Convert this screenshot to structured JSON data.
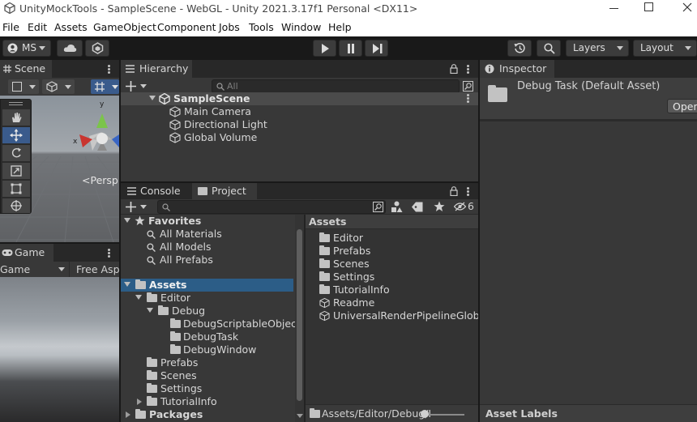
{
  "window": {
    "title": "UnityMockTools - SampleScene - WebGL - Unity 2021.3.17f1 Personal <DX11>"
  },
  "menu": [
    "File",
    "Edit",
    "Assets",
    "GameObject",
    "Component",
    "Jobs",
    "Tools",
    "Window",
    "Help"
  ],
  "toolbar": {
    "account": "MS",
    "layers": "Layers",
    "layout": "Layout"
  },
  "scene": {
    "tab": "Scene",
    "persp": "<Persp",
    "axis_y": "y",
    "axis_x": "x"
  },
  "game": {
    "tab": "Game",
    "display": "Game",
    "aspect": "Free Aspe"
  },
  "hierarchy": {
    "tab": "Hierarchy",
    "search_placeholder": "All",
    "scene": "SampleScene",
    "items": [
      "Main Camera",
      "Directional Light",
      "Global Volume"
    ]
  },
  "inspector": {
    "tab": "Inspector",
    "title": "Debug Task (Default Asset)",
    "open_button": "Open",
    "asset_labels": "Asset Labels"
  },
  "project": {
    "tabs": [
      "Console",
      "Project"
    ],
    "hidden_count": "6",
    "favorites": {
      "label": "Favorites",
      "items": [
        "All Materials",
        "All Models",
        "All Prefabs"
      ]
    },
    "tree": {
      "assets": "Assets",
      "editor": "Editor",
      "debug": "Debug",
      "debug_children": [
        "DebugScriptableObject",
        "DebugTask",
        "DebugWindow"
      ],
      "assets_children": [
        "Prefabs",
        "Scenes",
        "Settings",
        "TutorialInfo"
      ],
      "packages": "Packages"
    },
    "content_header": "Assets",
    "content_folders": [
      "Editor",
      "Prefabs",
      "Scenes",
      "Settings",
      "TutorialInfo"
    ],
    "content_assets": [
      "Readme",
      "UniversalRenderPipelineGlobalS"
    ],
    "path": "Assets/Editor/Debug/I"
  }
}
